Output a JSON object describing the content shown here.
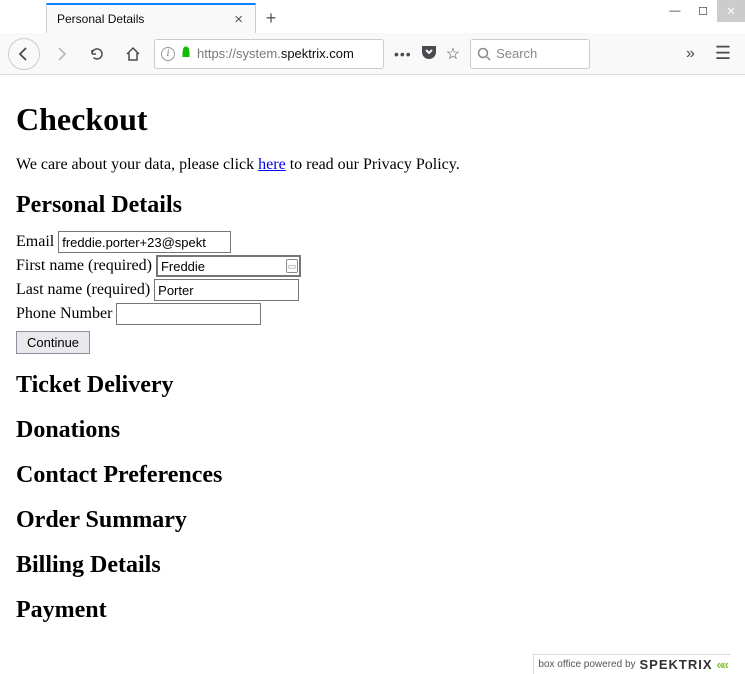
{
  "window": {
    "tab_title": "Personal Details"
  },
  "nav": {
    "url_prefix": "https://",
    "url_domain": "system.",
    "url_host": "spektrix.com",
    "search_placeholder": "Search"
  },
  "page": {
    "heading": "Checkout",
    "privacy_pre": "We care about your data, please click ",
    "privacy_link": "here",
    "privacy_post": " to read our Privacy Policy.",
    "section_personal": "Personal Details",
    "labels": {
      "email": "Email",
      "first_name": "First name (required)",
      "last_name": "Last name (required)",
      "phone": "Phone Number"
    },
    "values": {
      "email": "freddie.porter+23@spekt",
      "first_name": "Freddie",
      "last_name": "Porter",
      "phone": ""
    },
    "continue_label": "Continue",
    "section_ticket": "Ticket Delivery",
    "section_donations": "Donations",
    "section_contact": "Contact Preferences",
    "section_order": "Order Summary",
    "section_billing": "Billing Details",
    "section_payment": "Payment"
  },
  "footer": {
    "text": "box office powered by",
    "brand": "SPEKTRIX"
  }
}
